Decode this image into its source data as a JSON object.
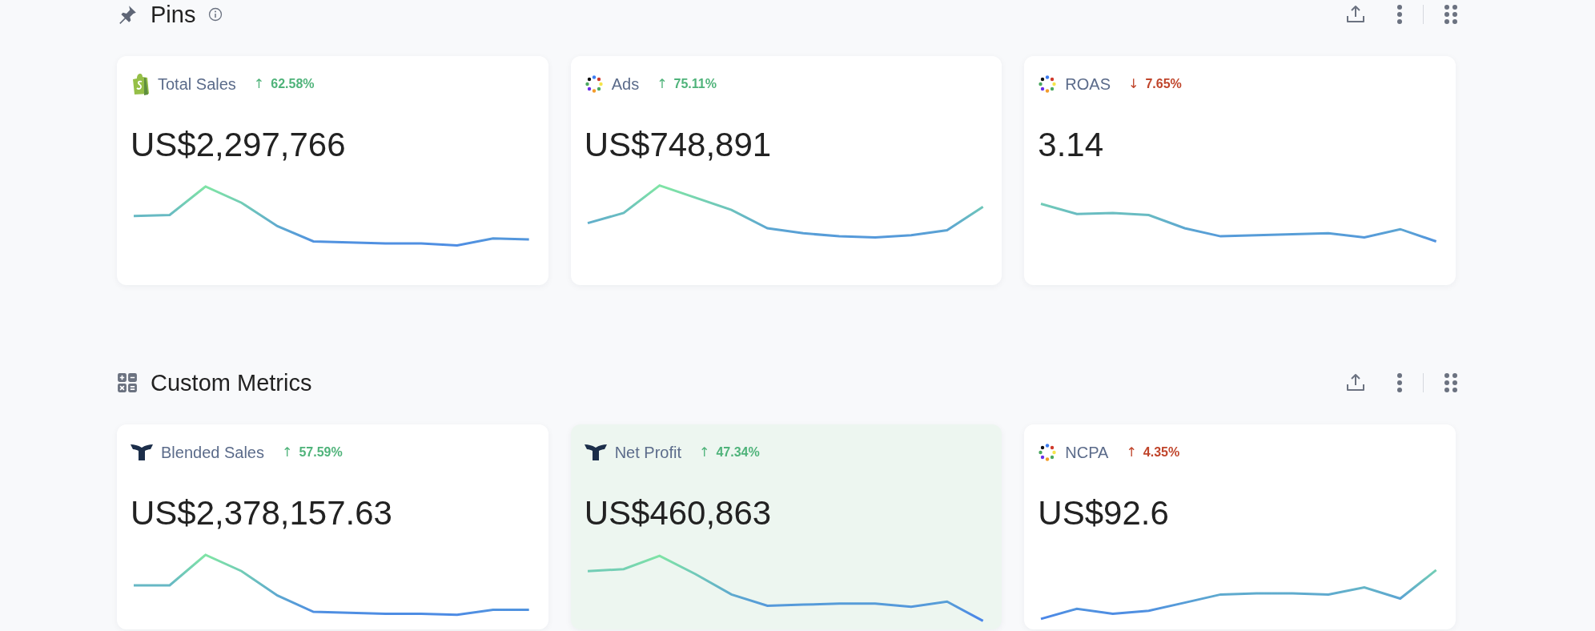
{
  "sections": [
    {
      "title": "Pins",
      "kind": "pin",
      "info": true,
      "cards": [
        {
          "kind": "bag",
          "label": "Total Sales",
          "arrow": "↑",
          "delta": "62.58%",
          "color": "#4fb37a",
          "value": "US$2,297,766",
          "highlighted": false
        },
        {
          "kind": "dots",
          "label": "Ads",
          "arrow": "↑",
          "delta": "75.11%",
          "color": "#4fb37a",
          "value": "US$748,891",
          "highlighted": false
        },
        {
          "kind": "dots",
          "label": "ROAS",
          "arrow": "↓",
          "delta": "7.65%",
          "color": "#c0452b",
          "value": "3.14",
          "highlighted": false
        }
      ]
    },
    {
      "title": "Custom Metrics",
      "kind": "calculator",
      "info": false,
      "cards": [
        {
          "kind": "tail",
          "label": "Blended Sales",
          "arrow": "↑",
          "delta": "57.59%",
          "color": "#4fb37a",
          "value": "US$2,378,157.63",
          "highlighted": false
        },
        {
          "kind": "tail",
          "label": "Net Profit",
          "arrow": "↑",
          "delta": "47.34%",
          "color": "#4fb37a",
          "value": "US$460,863",
          "highlighted": true
        },
        {
          "kind": "dots",
          "label": "NCPA",
          "arrow": "↑",
          "delta": "4.35%",
          "color": "#c0452b",
          "value": "US$92.6",
          "highlighted": false
        }
      ]
    }
  ]
}
